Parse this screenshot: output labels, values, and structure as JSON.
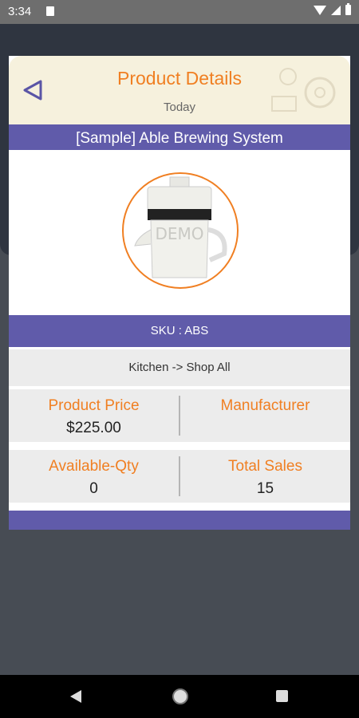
{
  "status_bar": {
    "time": "3:34"
  },
  "header": {
    "title": "Product Details",
    "subtitle": "Today"
  },
  "product": {
    "name": "[Sample] Able Brewing System",
    "image_watermark": "DEMO",
    "sku": "SKU : ABS",
    "category": "Kitchen -> Shop All",
    "price_label": "Product Price",
    "price_value": "$225.00",
    "manufacturer_label": "Manufacturer",
    "manufacturer_value": "",
    "available_label": "Available-Qty",
    "available_value": "0",
    "sales_label": "Total Sales",
    "sales_value": "15"
  },
  "colors": {
    "accent": "#f07f22",
    "primary": "#605baa",
    "header_bg": "#f6f1dd"
  },
  "icons": {
    "back": "back-triangle-icon",
    "nav_back": "nav-back-icon",
    "nav_home": "nav-home-icon",
    "nav_recent": "nav-recent-icon"
  }
}
